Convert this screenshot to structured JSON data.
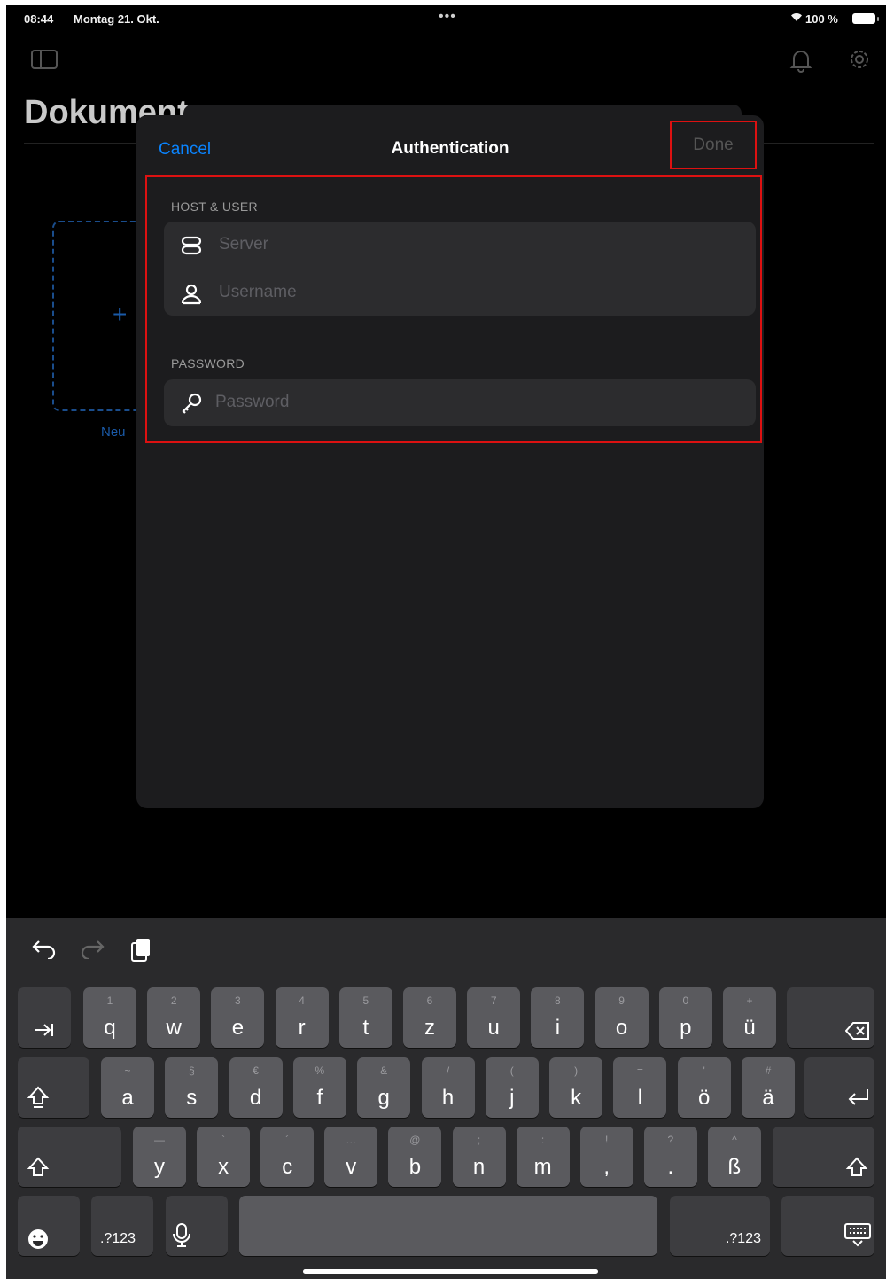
{
  "status_bar": {
    "time": "08:44",
    "date": "Montag 21. Okt.",
    "battery": "100 %"
  },
  "background": {
    "title": "Dokumente",
    "new_label": "Neu"
  },
  "sheet": {
    "cancel": "Cancel",
    "title": "Authentication",
    "done": "Done",
    "sections": {
      "host_user": "HOST & USER",
      "password": "PASSWORD"
    },
    "fields": {
      "server_placeholder": "Server",
      "username_placeholder": "Username",
      "password_placeholder": "Password"
    }
  },
  "keyboard": {
    "row1": [
      {
        "k": "q",
        "s": "1"
      },
      {
        "k": "w",
        "s": "2"
      },
      {
        "k": "e",
        "s": "3"
      },
      {
        "k": "r",
        "s": "4"
      },
      {
        "k": "t",
        "s": "5"
      },
      {
        "k": "z",
        "s": "6"
      },
      {
        "k": "u",
        "s": "7"
      },
      {
        "k": "i",
        "s": "8"
      },
      {
        "k": "o",
        "s": "9"
      },
      {
        "k": "p",
        "s": "0"
      },
      {
        "k": "ü",
        "s": "+"
      }
    ],
    "row2": [
      {
        "k": "a",
        "s": "~"
      },
      {
        "k": "s",
        "s": "§"
      },
      {
        "k": "d",
        "s": "€"
      },
      {
        "k": "f",
        "s": "%"
      },
      {
        "k": "g",
        "s": "&"
      },
      {
        "k": "h",
        "s": "/"
      },
      {
        "k": "j",
        "s": "("
      },
      {
        "k": "k",
        "s": ")"
      },
      {
        "k": "l",
        "s": "="
      },
      {
        "k": "ö",
        "s": "'"
      },
      {
        "k": "ä",
        "s": "#"
      }
    ],
    "row3": [
      {
        "k": "y",
        "s": "—"
      },
      {
        "k": "x",
        "s": "`"
      },
      {
        "k": "c",
        "s": "´"
      },
      {
        "k": "v",
        "s": "…"
      },
      {
        "k": "b",
        "s": "@"
      },
      {
        "k": "n",
        "s": ";"
      },
      {
        "k": "m",
        "s": ":"
      },
      {
        "k": ",",
        "s": "!"
      },
      {
        "k": ".",
        "s": "?"
      },
      {
        "k": "ß",
        "s": "^"
      }
    ],
    "numbers_label": ".?123"
  }
}
